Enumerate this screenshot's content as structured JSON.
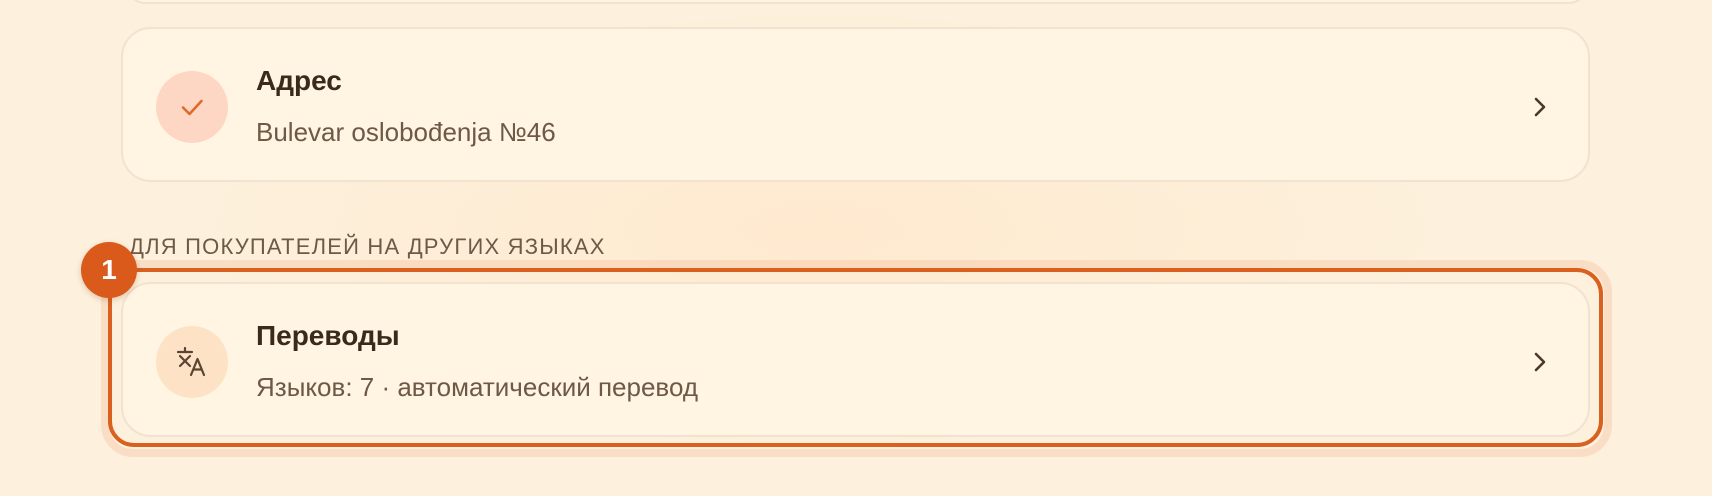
{
  "address_card": {
    "title": "Адрес",
    "subtitle": "Bulevar oslobođenja №46",
    "icon": "check-icon",
    "status_color": "#e06a2c"
  },
  "section": {
    "label": "ДЛЯ ПОКУПАТЕЛЕЙ НА ДРУГИХ ЯЗЫКАХ"
  },
  "translations_card": {
    "title": "Переводы",
    "subtitle": "Языков: 7 · автоматический перевод",
    "icon": "translate-icon"
  },
  "highlight": {
    "step_number": "1",
    "color": "#d9601f"
  }
}
